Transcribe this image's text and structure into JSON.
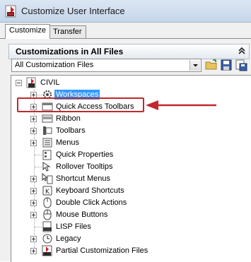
{
  "window": {
    "title": "Customize User Interface",
    "icon": "app-icon"
  },
  "tabs": [
    {
      "label": "Customize",
      "active": true
    },
    {
      "label": "Transfer",
      "active": false
    }
  ],
  "panel": {
    "title": "Customizations in All Files",
    "collapse_icon": "chevron-up-icon"
  },
  "filter": {
    "selected": "All Customization Files",
    "toolbar_icons": [
      "open-file-icon",
      "save-icon",
      "load-partial-icon"
    ]
  },
  "tree": {
    "root": "CIVIL",
    "items": [
      {
        "label": "Workspaces",
        "icon": "gear-icon",
        "selected": true
      },
      {
        "label": "Quick Access Toolbars",
        "icon": "toolbar-icon",
        "selected": false
      },
      {
        "label": "Ribbon",
        "icon": "ribbon-icon",
        "selected": false
      },
      {
        "label": "Toolbars",
        "icon": "toolbars-icon",
        "selected": false
      },
      {
        "label": "Menus",
        "icon": "menu-icon",
        "selected": false
      },
      {
        "label": "Quick Properties",
        "icon": "properties-icon",
        "selected": false
      },
      {
        "label": "Rollover Tooltips",
        "icon": "tooltip-icon",
        "selected": false
      },
      {
        "label": "Shortcut Menus",
        "icon": "shortcut-menu-icon",
        "selected": false
      },
      {
        "label": "Keyboard Shortcuts",
        "icon": "keyboard-icon",
        "selected": false
      },
      {
        "label": "Double Click Actions",
        "icon": "double-click-icon",
        "selected": false
      },
      {
        "label": "Mouse Buttons",
        "icon": "mouse-icon",
        "selected": false
      },
      {
        "label": "LISP Files",
        "icon": "lisp-icon",
        "selected": false
      },
      {
        "label": "Legacy",
        "icon": "clock-icon",
        "selected": false
      },
      {
        "label": "Partial Customization Files",
        "icon": "cui-file-icon",
        "selected": false
      }
    ]
  },
  "annotation": {
    "color": "#c0282d",
    "target": "Quick Access Toolbars"
  },
  "colors": {
    "selection": "#3399ff",
    "accent_red": "#c0282d"
  }
}
